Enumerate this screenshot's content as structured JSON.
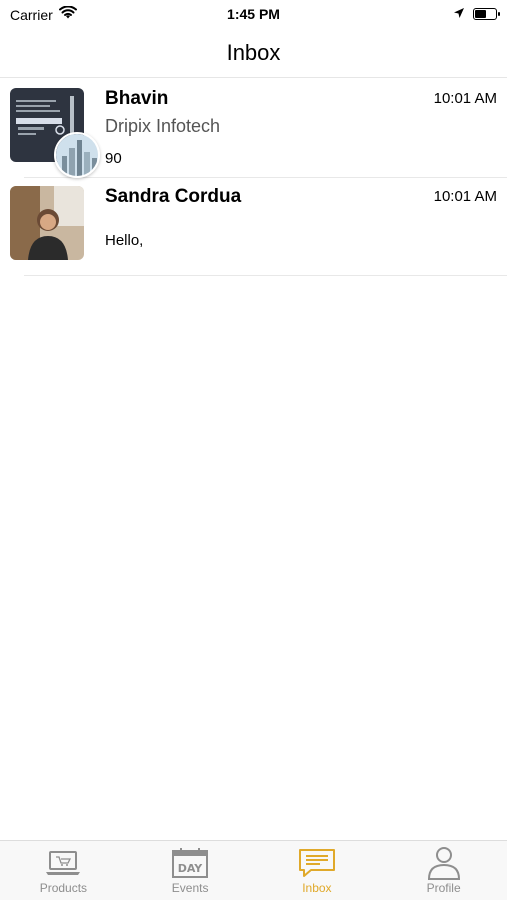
{
  "status_bar": {
    "carrier": "Carrier",
    "time": "1:45 PM"
  },
  "nav": {
    "title": "Inbox"
  },
  "conversations": [
    {
      "name": "Bhavin",
      "subtitle": "Dripix Infotech",
      "message": "90",
      "time": "10:01 AM"
    },
    {
      "name": "Sandra Cordua",
      "subtitle": "",
      "message": "Hello,",
      "time": "10:01 AM"
    }
  ],
  "tabs": [
    {
      "label": "Products",
      "icon": "laptop-cart-icon",
      "active": false
    },
    {
      "label": "Events",
      "icon": "calendar-day-icon",
      "active": false
    },
    {
      "label": "Inbox",
      "icon": "chat-bubble-icon",
      "active": true
    },
    {
      "label": "Profile",
      "icon": "person-icon",
      "active": false
    }
  ],
  "colors": {
    "accent": "#e0a92a",
    "inactive": "#8e8e8e"
  }
}
